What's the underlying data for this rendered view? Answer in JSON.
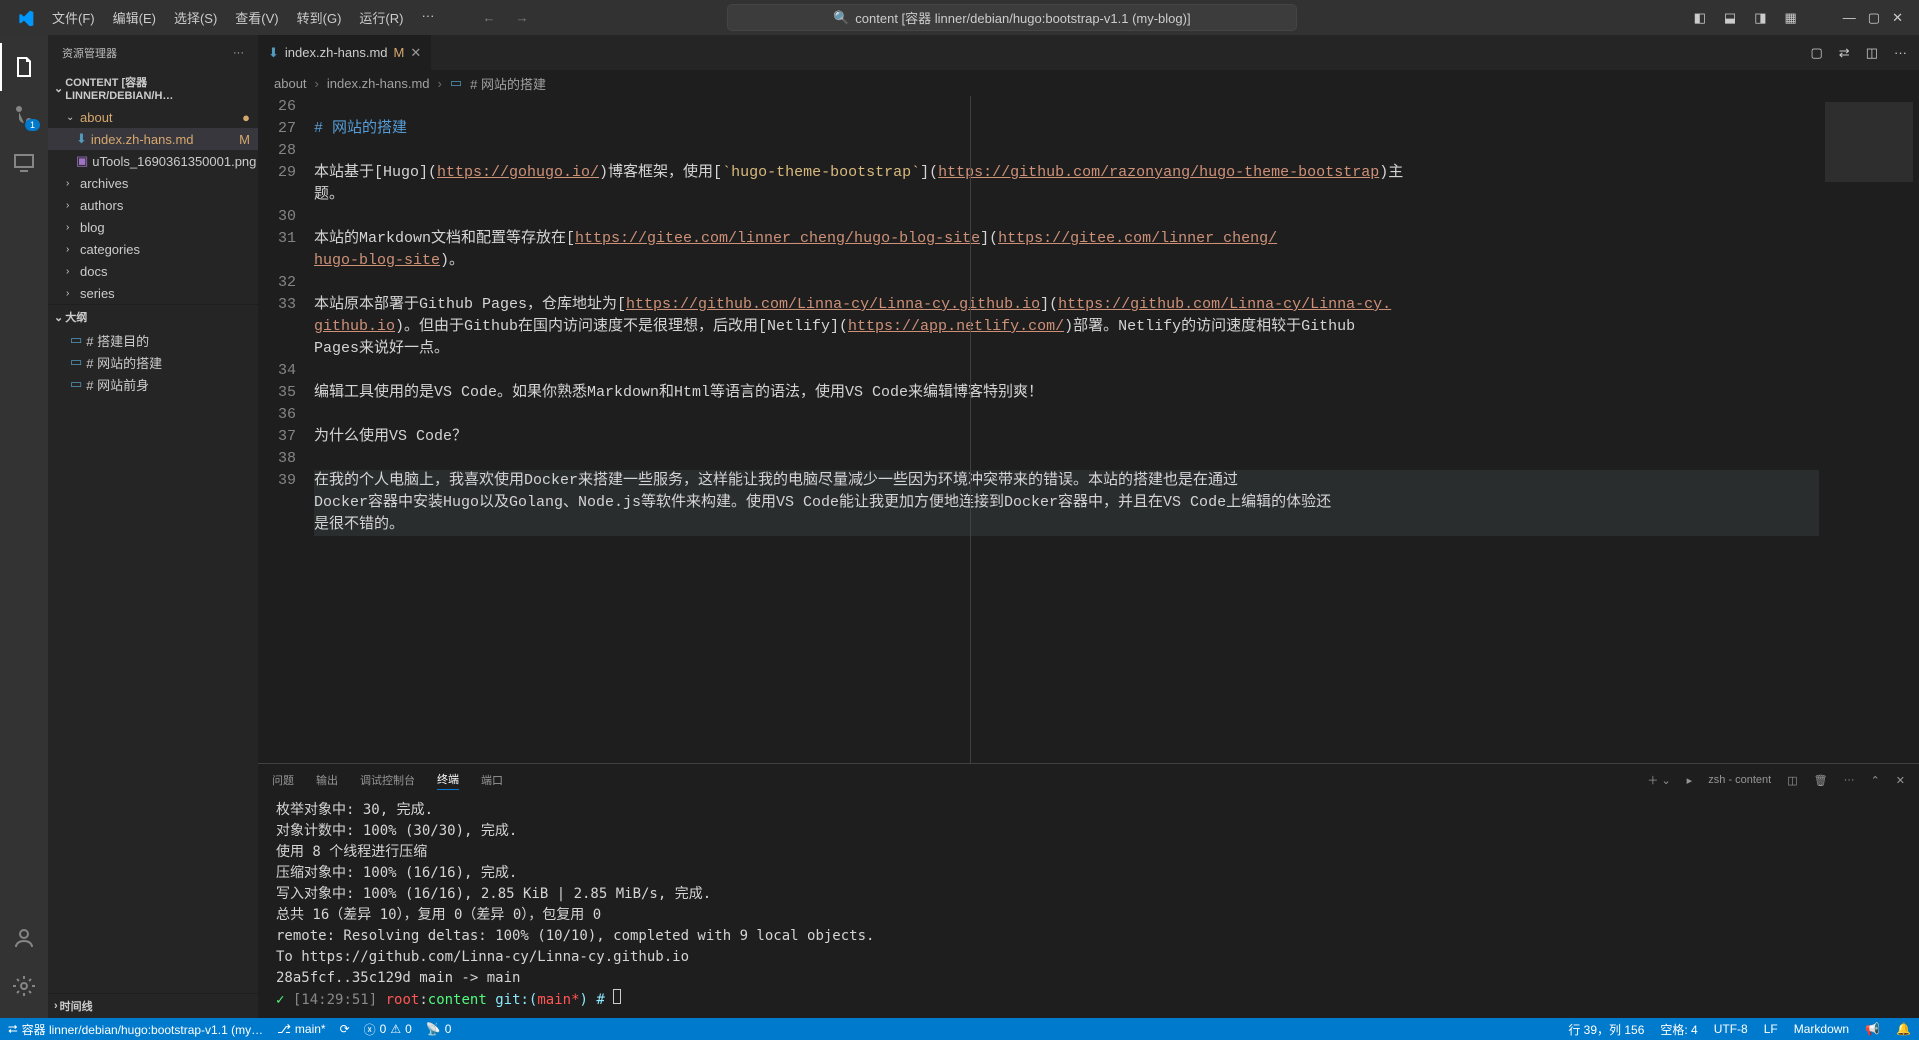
{
  "menu": {
    "file": "文件(F)",
    "edit": "编辑(E)",
    "select": "选择(S)",
    "view": "查看(V)",
    "goto": "转到(G)",
    "run": "运行(R)",
    "more": "···"
  },
  "search": {
    "placeholder": "content [容器 linner/debian/hugo:bootstrap-v1.1 (my-blog)]"
  },
  "sidebar": {
    "title": "资源管理器",
    "project": "CONTENT [容器 LINNER/DEBIAN/H…",
    "items": [
      {
        "label": "about",
        "kind": "folder",
        "mod": true
      },
      {
        "label": "index.zh-hans.md",
        "kind": "file",
        "mod": true,
        "badge": "M"
      },
      {
        "label": "uTools_1690361350001.png",
        "kind": "file"
      },
      {
        "label": "archives",
        "kind": "folder"
      },
      {
        "label": "authors",
        "kind": "folder"
      },
      {
        "label": "blog",
        "kind": "folder"
      },
      {
        "label": "categories",
        "kind": "folder"
      },
      {
        "label": "docs",
        "kind": "folder"
      },
      {
        "label": "series",
        "kind": "folder"
      }
    ],
    "outline": {
      "title": "大纲",
      "items": [
        "# 搭建目的",
        "# 网站的搭建",
        "# 网站前身"
      ]
    },
    "timeline": "时间线"
  },
  "tab": {
    "name": "index.zh-hans.md",
    "mod": "M"
  },
  "breadcrumbs": [
    "about",
    "index.zh-hans.md",
    "# 网站的搭建"
  ],
  "code": {
    "start": 26,
    "lines": [
      "",
      "# 网站的搭建",
      "",
      "本站基于[Hugo](https://gohugo.io/)博客框架，使用[`hugo-theme-bootstrap`](https://github.com/razonyang/hugo-theme-bootstrap)主题。",
      "",
      "本站的Markdown文档和配置等存放在[https://gitee.com/linner_cheng/hugo-blog-site](https://gitee.com/linner_cheng/hugo-blog-site)。",
      "",
      "本站原本部署于Github Pages，仓库地址为[https://github.com/Linna-cy/Linna-cy.github.io](https://github.com/Linna-cy/Linna-cy.github.io)。但由于Github在国内访问速度不是很理想，后改用[Netlify](https://app.netlify.com/)部署。Netlify的访问速度相较于Github Pages来说好一点。",
      "",
      "编辑工具使用的是VS Code。如果你熟悉Markdown和Html等语言的语法，使用VS Code来编辑博客特别爽！",
      "",
      "为什么使用VS Code？",
      "",
      "在我的个人电脑上，我喜欢使用Docker来搭建一些服务，这样能让我的电脑尽量减少一些因为环境冲突带来的错误。本站的搭建也是在通过Docker容器中安装Hugo以及Golang、Node.js等软件来构建。使用VS Code能让我更加方便地连接到Docker容器中，并且在VS Code上编辑的体验还是很不错的。"
    ]
  },
  "panel": {
    "tabs": [
      "问题",
      "输出",
      "调试控制台",
      "终端",
      "端口"
    ],
    "active": 3,
    "terminal_label": "zsh - content",
    "lines": [
      "枚举对象中: 30, 完成.",
      "对象计数中: 100% (30/30), 完成.",
      "使用 8 个线程进行压缩",
      "压缩对象中: 100% (16/16), 完成.",
      "写入对象中: 100% (16/16), 2.85 KiB | 2.85 MiB/s, 完成.",
      "总共 16（差异 10），复用 0（差异 0），包复用 0",
      "remote: Resolving deltas: 100% (10/10), completed with 9 local objects.",
      "To https://github.com/Linna-cy/Linna-cy.github.io",
      "   28a5fcf..35c129d  main -> main"
    ],
    "prompt": {
      "time": "[14:29:51]",
      "user": "root",
      "sep": ":",
      "path": "content",
      "git": "git:(",
      "branch": "main*",
      "gitend": ") # "
    }
  },
  "status": {
    "remote": "容器 linner/debian/hugo:bootstrap-v1.1 (my…",
    "branch": "main*",
    "errors": "0",
    "warnings": "0",
    "ports": "0",
    "cursor": "行 39，列 156",
    "spaces": "空格: 4",
    "encoding": "UTF-8",
    "eol": "LF",
    "lang": "Markdown"
  },
  "scm_badge": "1"
}
